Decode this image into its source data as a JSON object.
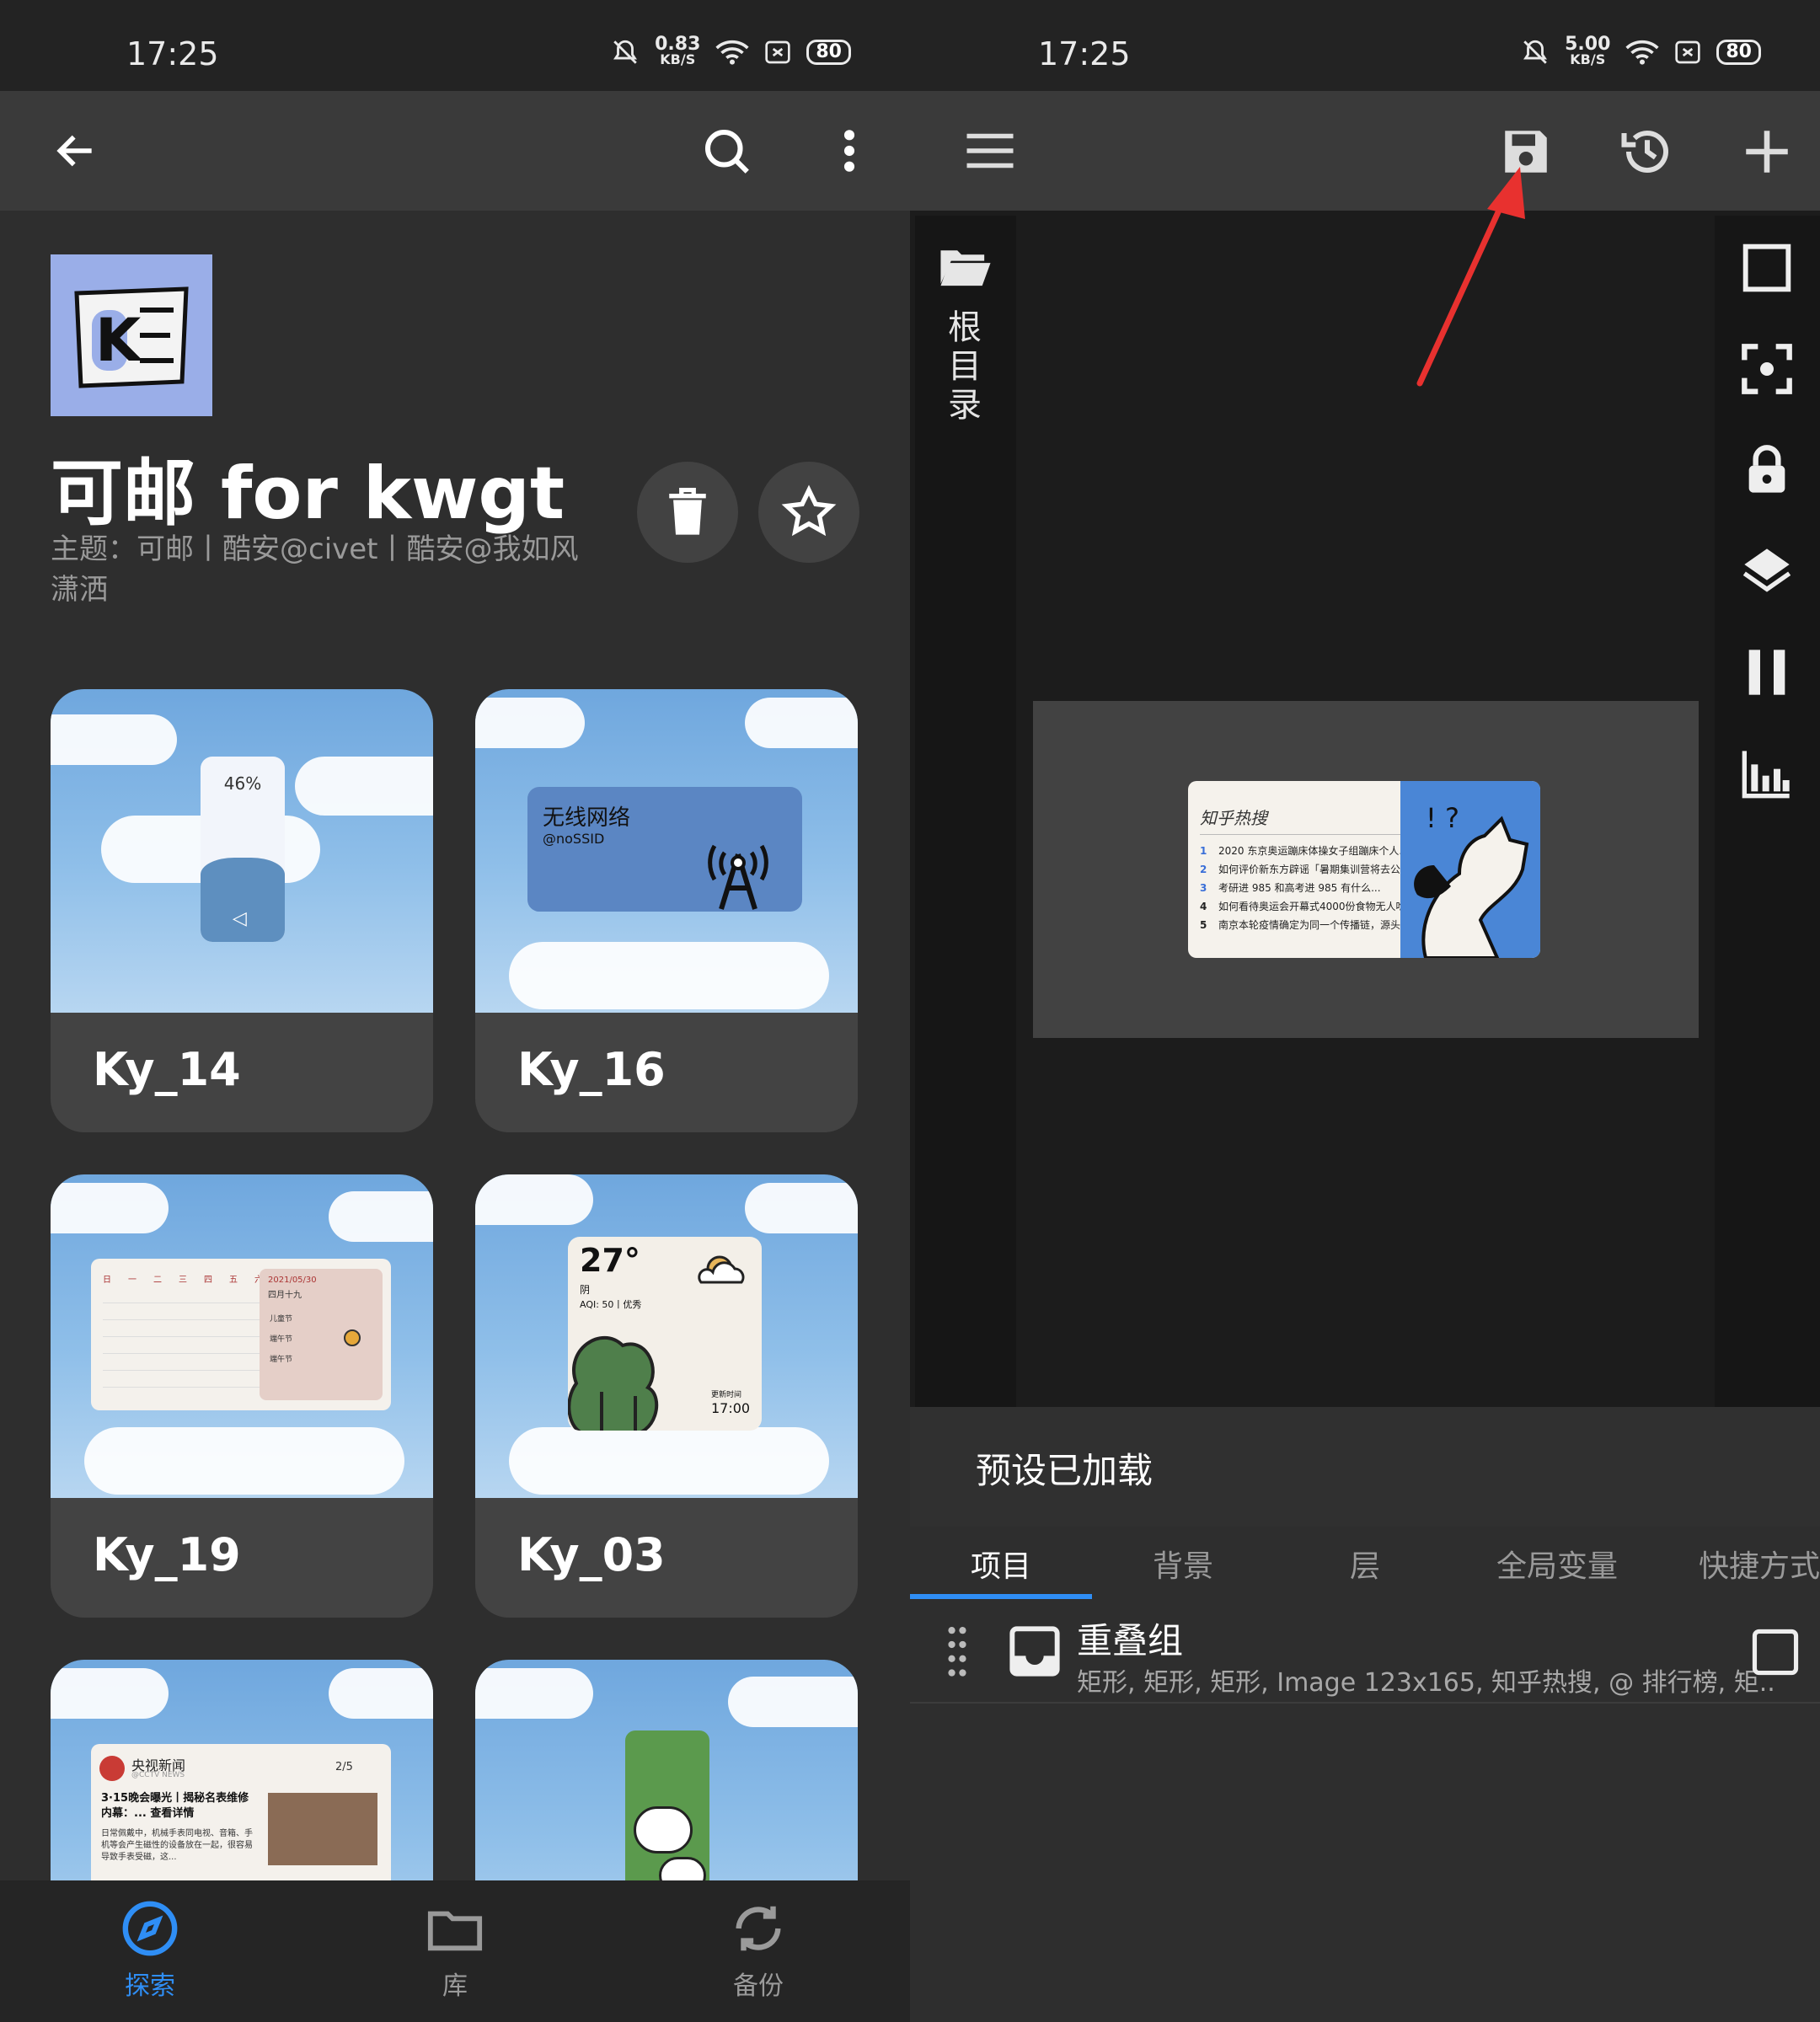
{
  "left": {
    "status": {
      "time": "17:25",
      "speed_value": "0.83",
      "speed_unit": "KB/S",
      "battery": "80"
    },
    "preset": {
      "title": "可邮 for kwgt",
      "subtitle": "主题：可邮丨酷安@civet丨酷安@我如风潇洒",
      "logo_letter": "K"
    },
    "cards": [
      {
        "name": "Ky_14",
        "preview": {
          "percent": "46%"
        }
      },
      {
        "name": "Ky_16",
        "preview": {
          "label": "无线网络",
          "sub": "@noSSID"
        }
      },
      {
        "name": "Ky_19",
        "preview": {
          "weekdays": [
            "日",
            "一",
            "二",
            "三",
            "四",
            "五",
            "六"
          ],
          "date": "2021/05/30",
          "lunar": "四月十九",
          "events": [
            "儿童节",
            "端午节",
            "端午节"
          ]
        }
      },
      {
        "name": "Ky_03",
        "preview": {
          "temp": "27°",
          "weather": "阴",
          "aqi": "AQI: 50丨优秀",
          "update_label": "更新时间",
          "update_time": "17:00"
        }
      },
      {
        "name": "",
        "preview": {
          "source": "央视新闻",
          "source_sub": "@CCTV NEWS",
          "page": "2/5",
          "headline": "3·15晚会曝光丨揭秘名表维修内幕：... 查看详情",
          "body": "日常佩戴中，机械手表同电视、音箱、手机等会产生磁性的设备放在一起，很容易导致手表受磁，这..."
        }
      },
      {
        "name": "",
        "preview": {}
      }
    ],
    "nav": [
      {
        "label": "探索",
        "icon": "compass-icon",
        "active": true
      },
      {
        "label": "库",
        "icon": "folder-icon",
        "active": false
      },
      {
        "label": "备份",
        "icon": "sync-icon",
        "active": false
      }
    ],
    "accent": "#2f8ef5"
  },
  "right": {
    "status": {
      "time": "17:25",
      "speed_value": "5.00",
      "speed_unit": "KB/S",
      "battery": "80"
    },
    "folder_label": "根目录",
    "widget": {
      "title": "知乎热搜",
      "items": [
        {
          "n": "1",
          "text": "2020 东京奥运蹦床体操女子组蹦床个人..."
        },
        {
          "n": "2",
          "text": "如何评价新东方辟谣「暑期集训营将去公海集..."
        },
        {
          "n": "3",
          "text": "考研进 985 和高考进 985 有什么..."
        },
        {
          "n": "4",
          "text": "如何看待奥运会开幕式4000份食物无人吃..."
        },
        {
          "n": "5",
          "text": "南京本轮疫情确定为同一个传播链，源头为俄..."
        }
      ]
    },
    "status_message": "预设已加载",
    "tabs": [
      "项目",
      "背景",
      "层",
      "全局变量",
      "快捷方式"
    ],
    "list": [
      {
        "title": "重叠组",
        "subtitle": "矩形, 矩形, 矩形, Image 123x165, 知乎热搜, @ 排行榜, 矩.."
      }
    ],
    "annotation_color": "#e8312f"
  }
}
